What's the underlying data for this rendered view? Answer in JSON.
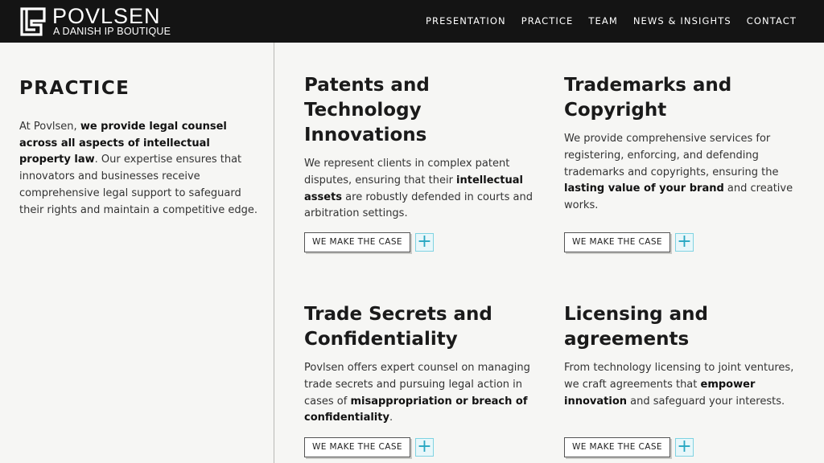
{
  "brand": {
    "name": "POVLSEN",
    "tagline": "A DANISH IP BOUTIQUE",
    "logo_icon": "povlsen-monogram-icon"
  },
  "nav": [
    "PRESENTATION",
    "PRACTICE",
    "TEAM",
    "NEWS & INSIGHTS",
    "CONTACT"
  ],
  "intro": {
    "title": "PRACTICE",
    "text_a": "At Povlsen, ",
    "text_b": "we provide legal counsel across all aspects of intellectual property law",
    "text_c": ". Our expertise ensures that innovators and businesses receive comprehensive legal support to safeguard their rights and maintain a competitive edge."
  },
  "cards": [
    {
      "title": "Patents and Technology Innovations",
      "text_a": "We represent clients in complex patent disputes, ensuring that their ",
      "text_b": "intellectual assets",
      "text_c": " are robustly defended in courts and arbitration settings.",
      "button": "WE MAKE THE CASE",
      "plus": "+"
    },
    {
      "title": "Trademarks and Copyright",
      "text_a": "We provide comprehensive services for registering, enforcing, and defending trademarks and copyrights, ensuring the ",
      "text_b": "lasting value of your brand",
      "text_c": " and creative works.",
      "button": "WE MAKE THE CASE",
      "plus": "+"
    },
    {
      "title": "Trade Secrets and Confidentiality",
      "text_a": "Povlsen offers expert counsel on managing trade secrets and pursuing legal action in cases of ",
      "text_b": "misappropriation or breach of confidentiality",
      "text_c": ".",
      "button": "WE MAKE THE CASE",
      "plus": "+"
    },
    {
      "title": "Licensing and agreements",
      "text_a": "From technology licensing to joint ventures, we craft agreements that ",
      "text_b": "empower innovation",
      "text_c": " and safeguard your interests.",
      "button": "WE MAKE THE CASE",
      "plus": "+"
    }
  ],
  "colors": {
    "topbar": "#141414",
    "background": "#f6f6f4",
    "accent": "#27a7c2"
  }
}
